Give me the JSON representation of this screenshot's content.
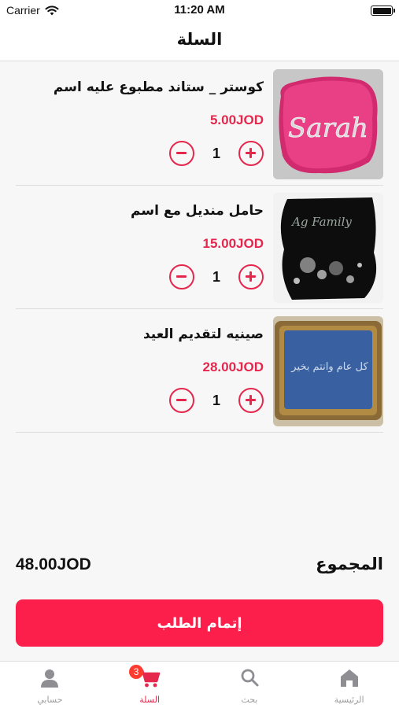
{
  "status_bar": {
    "carrier": "Carrier",
    "time": "11:20 AM"
  },
  "header": {
    "title": "السلة"
  },
  "cart": {
    "items": [
      {
        "name": "كوستر _ ستاند مطبوع عليه اسم",
        "price": "5.00JOD",
        "quantity": "1",
        "image_icon": "pink-name-coaster-image",
        "image_text": "Sarah"
      },
      {
        "name": "حامل منديل مع اسم",
        "price": "15.00JOD",
        "quantity": "1",
        "image_icon": "black-tissue-holder-image",
        "image_text": "Ag Family"
      },
      {
        "name": "صينيه لتقديم العيد",
        "price": "28.00JOD",
        "quantity": "1",
        "image_icon": "blue-gold-tray-image",
        "image_text": "كل عام وانتم بخير"
      }
    ]
  },
  "summary": {
    "total_label": "المجموع",
    "total_value": "48.00JOD"
  },
  "checkout": {
    "label": "إتمام الطلب"
  },
  "tab_bar": {
    "tabs": [
      {
        "label": "حسابي",
        "icon": "user-icon"
      },
      {
        "label": "السلة",
        "icon": "cart-icon",
        "badge": "3"
      },
      {
        "label": "بحث",
        "icon": "search-icon"
      },
      {
        "label": "الرئيسية",
        "icon": "home-icon"
      }
    ]
  },
  "colors": {
    "accent": "#e5264d",
    "button": "#fd1f4b",
    "badge": "#ff3b30"
  }
}
